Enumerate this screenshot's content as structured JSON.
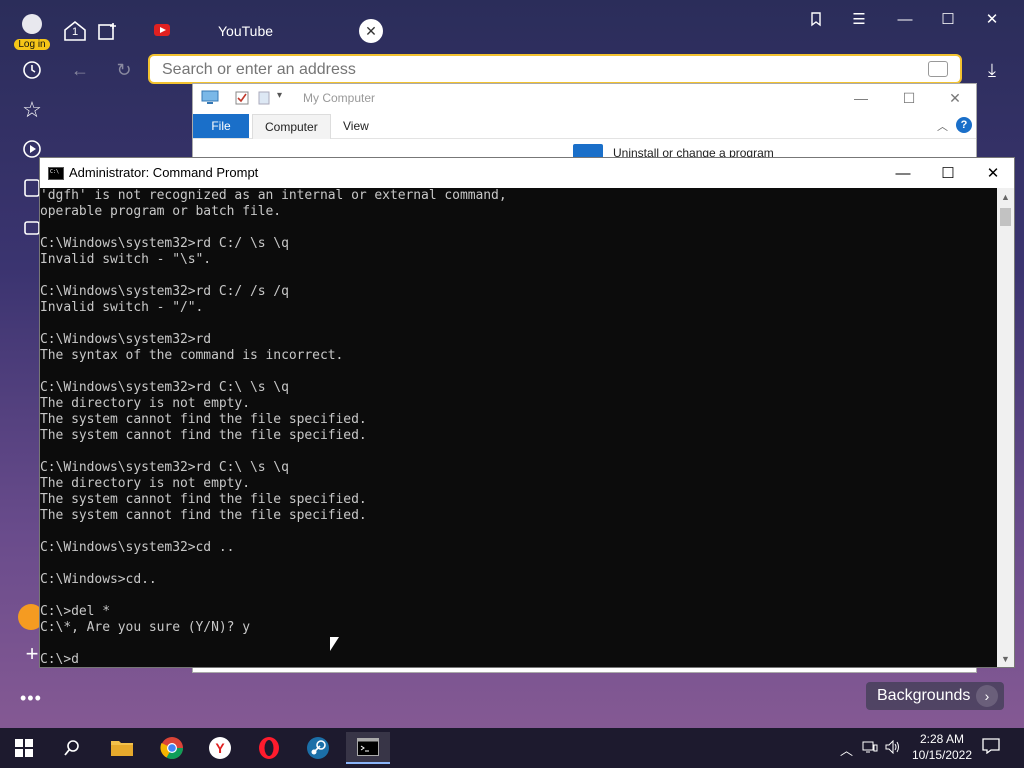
{
  "browser": {
    "login_label": "Log in",
    "tab_title": "YouTube",
    "tab_count": "1",
    "address_placeholder": "Search or enter an address",
    "backgrounds_label": "Backgrounds",
    "accent_color": "#f2c230"
  },
  "explorer": {
    "title": "My Computer",
    "tabs": [
      "File",
      "Computer",
      "View"
    ],
    "uninstall_label": "Uninstall or change a program",
    "help_label": "?"
  },
  "cmd": {
    "title": "Administrator: Command Prompt",
    "lines": [
      "'dgfh' is not recognized as an internal or external command,",
      "operable program or batch file.",
      "",
      "C:\\Windows\\system32>rd C:/ \\s \\q",
      "Invalid switch - \"\\s\".",
      "",
      "C:\\Windows\\system32>rd C:/ /s /q",
      "Invalid switch - \"/\".",
      "",
      "C:\\Windows\\system32>rd",
      "The syntax of the command is incorrect.",
      "",
      "C:\\Windows\\system32>rd C:\\ \\s \\q",
      "The directory is not empty.",
      "The system cannot find the file specified.",
      "The system cannot find the file specified.",
      "",
      "C:\\Windows\\system32>rd C:\\ \\s \\q",
      "The directory is not empty.",
      "The system cannot find the file specified.",
      "The system cannot find the file specified.",
      "",
      "C:\\Windows\\system32>cd ..",
      "",
      "C:\\Windows>cd..",
      "",
      "C:\\>del *",
      "C:\\*, Are you sure (Y/N)? y",
      "",
      "C:\\>d"
    ]
  },
  "taskbar": {
    "time": "2:28 AM",
    "date": "10/15/2022",
    "apps": [
      "file-explorer",
      "chrome",
      "yandex",
      "opera",
      "steam",
      "command-prompt"
    ]
  }
}
